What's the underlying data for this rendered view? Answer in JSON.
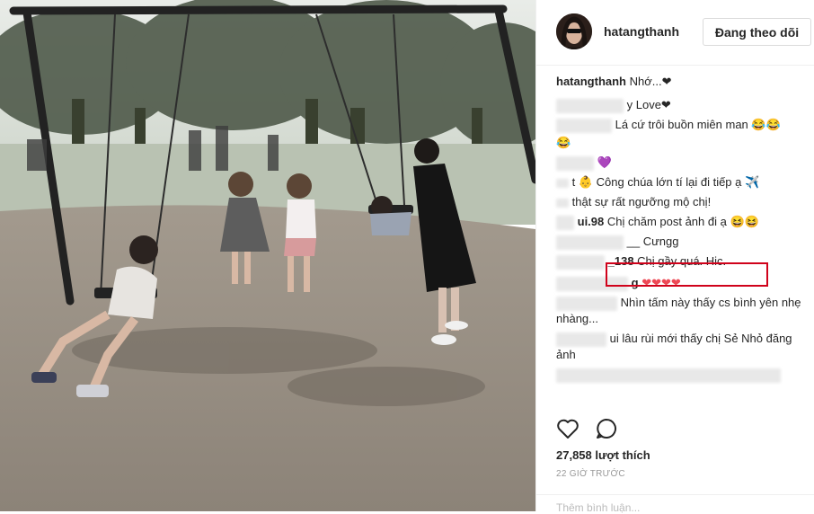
{
  "post": {
    "username": "hatangthanh",
    "follow_label": "Đang theo dõi",
    "caption_handle": "hatangthanh",
    "caption_text": "Nhớ...❤"
  },
  "comments": [
    {
      "handle": "",
      "text": "y Love❤"
    },
    {
      "handle": "",
      "text": "Lá cứ trôi buồn miên man 😂😂"
    },
    {
      "handle": "",
      "text": "😂"
    },
    {
      "handle": "",
      "text": "💜"
    },
    {
      "handle": "",
      "text": "t 👶 Công chúa lớn tí lại đi tiếp ạ ✈️"
    },
    {
      "handle": "",
      "text": "thật sự rất ngưỡng mộ chị!"
    },
    {
      "handle": "ui.98",
      "text": "Chị chăm post ảnh đi ạ 😆😆"
    },
    {
      "handle": "",
      "text": "__ Cưngg"
    },
    {
      "handle": "_138",
      "text": "Chị gầy quá. Hic."
    },
    {
      "handle": "g",
      "text": "❤❤❤❤"
    },
    {
      "handle": "",
      "text": "Nhìn tấm này thấy cs bình yên nhẹ nhàng..."
    },
    {
      "handle": "",
      "text": "ui lâu rùi mới thấy chị Sẻ Nhỏ đăng ảnh"
    }
  ],
  "likes": "27,858 lượt thích",
  "time": "22 GIỜ TRƯỚC",
  "add_comment": "Thêm bình luận...",
  "colors": {
    "highlight": "#d0021b",
    "text": "#262626",
    "muted": "#999999"
  }
}
